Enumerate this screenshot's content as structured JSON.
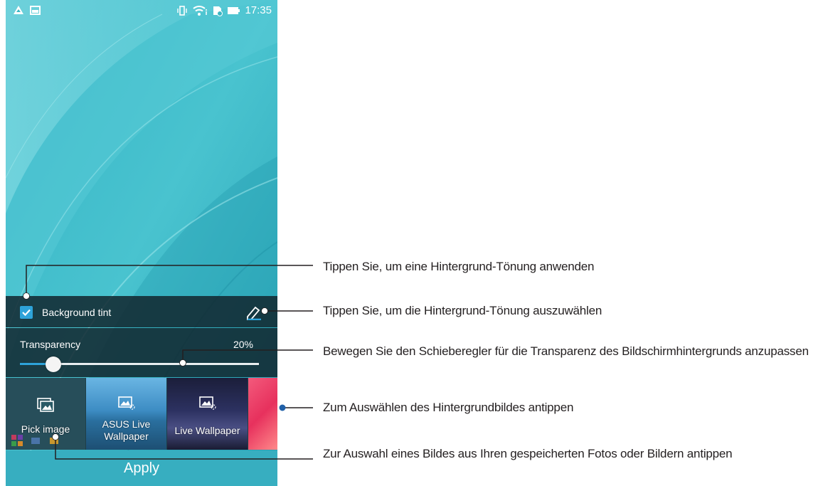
{
  "status_bar": {
    "time": "17:35",
    "left_icons": [
      "alert-icon",
      "photo-notification-icon"
    ],
    "right_icons": [
      "vibrate-icon",
      "wifi-icon",
      "no-sim-icon",
      "battery-icon"
    ]
  },
  "panel": {
    "tint_label": "Background tint",
    "tint_checked": true,
    "transparency_label": "Transparency",
    "transparency_value": "20%",
    "transparency_fraction": 0.14,
    "accent_color": "#2ea3d9"
  },
  "thumbnails": [
    {
      "label": "Pick image",
      "icon": "gallery-icon"
    },
    {
      "label": "ASUS Live Wallpaper",
      "line1": "ASUS Live",
      "line2": "Wallpaper",
      "icon": "live-wallpaper-icon"
    },
    {
      "label": "Live Wallpaper",
      "icon": "live-wallpaper-icon"
    },
    {
      "label": "",
      "icon": ""
    }
  ],
  "apply_label": "Apply",
  "callouts": [
    "Tippen Sie, um eine Hintergrund-Tönung anwenden",
    "Tippen Sie, um die Hintergrund-Tönung auszuwählen",
    "Bewegen Sie den Schieberegler für die Transparenz des Bildschirmhintergrunds anzupassen",
    "Zum Auswählen des Hintergrundbildes antippen",
    "Zur Auswahl eines Bildes aus Ihren gespeicherten Fotos oder Bildern antippen"
  ],
  "colors": {
    "wallpaper": "#3bb6c4",
    "apply_bar": "#37aec0",
    "callout_line": "#231f20"
  }
}
